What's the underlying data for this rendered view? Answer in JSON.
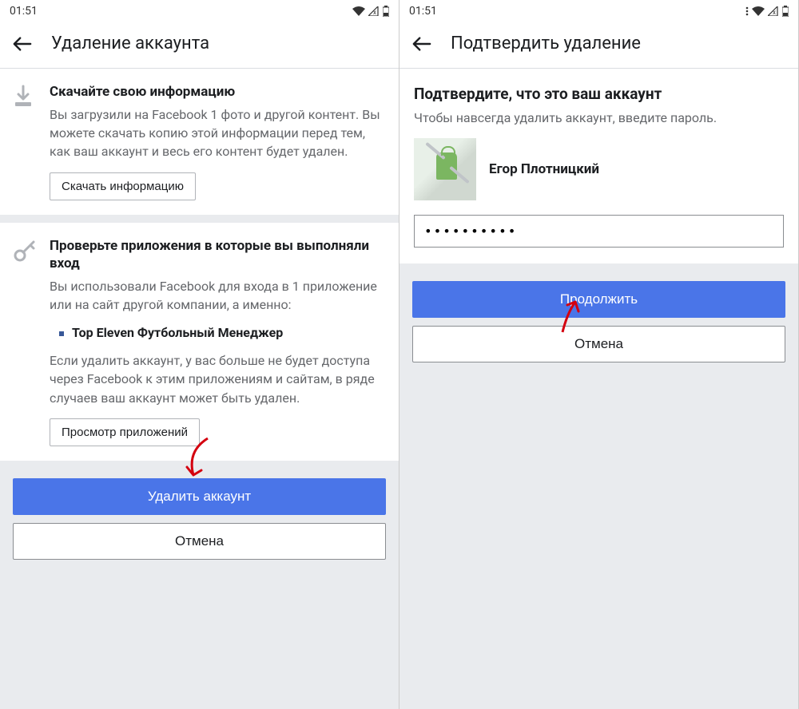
{
  "status": {
    "time": "01:51"
  },
  "left": {
    "header_title": "Удаление аккаунта",
    "section1": {
      "title": "Скачайте свою информацию",
      "text": "Вы загрузили на Facebook 1 фото и другой контент. Вы можете скачать копию этой информации перед тем, как ваш аккаунт и весь его контент будет удален.",
      "button": "Скачать информацию"
    },
    "section2": {
      "title": "Проверьте приложения в которые вы выполняли вход",
      "text_before": "Вы использовали Facebook для входа в 1 приложение или на сайт другой компании, а именно:",
      "app": "Top Eleven Футбольный Менеджер",
      "text_after": "Если удалить аккаунт, у вас больше не будет доступа через Facebook к этим приложениям и сайтам, в ряде случаев ваш аккаунт может быть удален.",
      "button": "Просмотр приложений"
    },
    "footer": {
      "delete": "Удалить аккаунт",
      "cancel": "Отмена"
    }
  },
  "right": {
    "header_title": "Подтвердить удаление",
    "title": "Подтвердите, что это ваш аккаунт",
    "subtitle": "Чтобы навсегда удалить аккаунт, введите пароль.",
    "user_name": "Егор Плотницкий",
    "password_mask": "••••••••••",
    "continue": "Продолжить",
    "cancel": "Отмена"
  },
  "colors": {
    "primary": "#4a75e8",
    "annotation": "#d4000f"
  }
}
